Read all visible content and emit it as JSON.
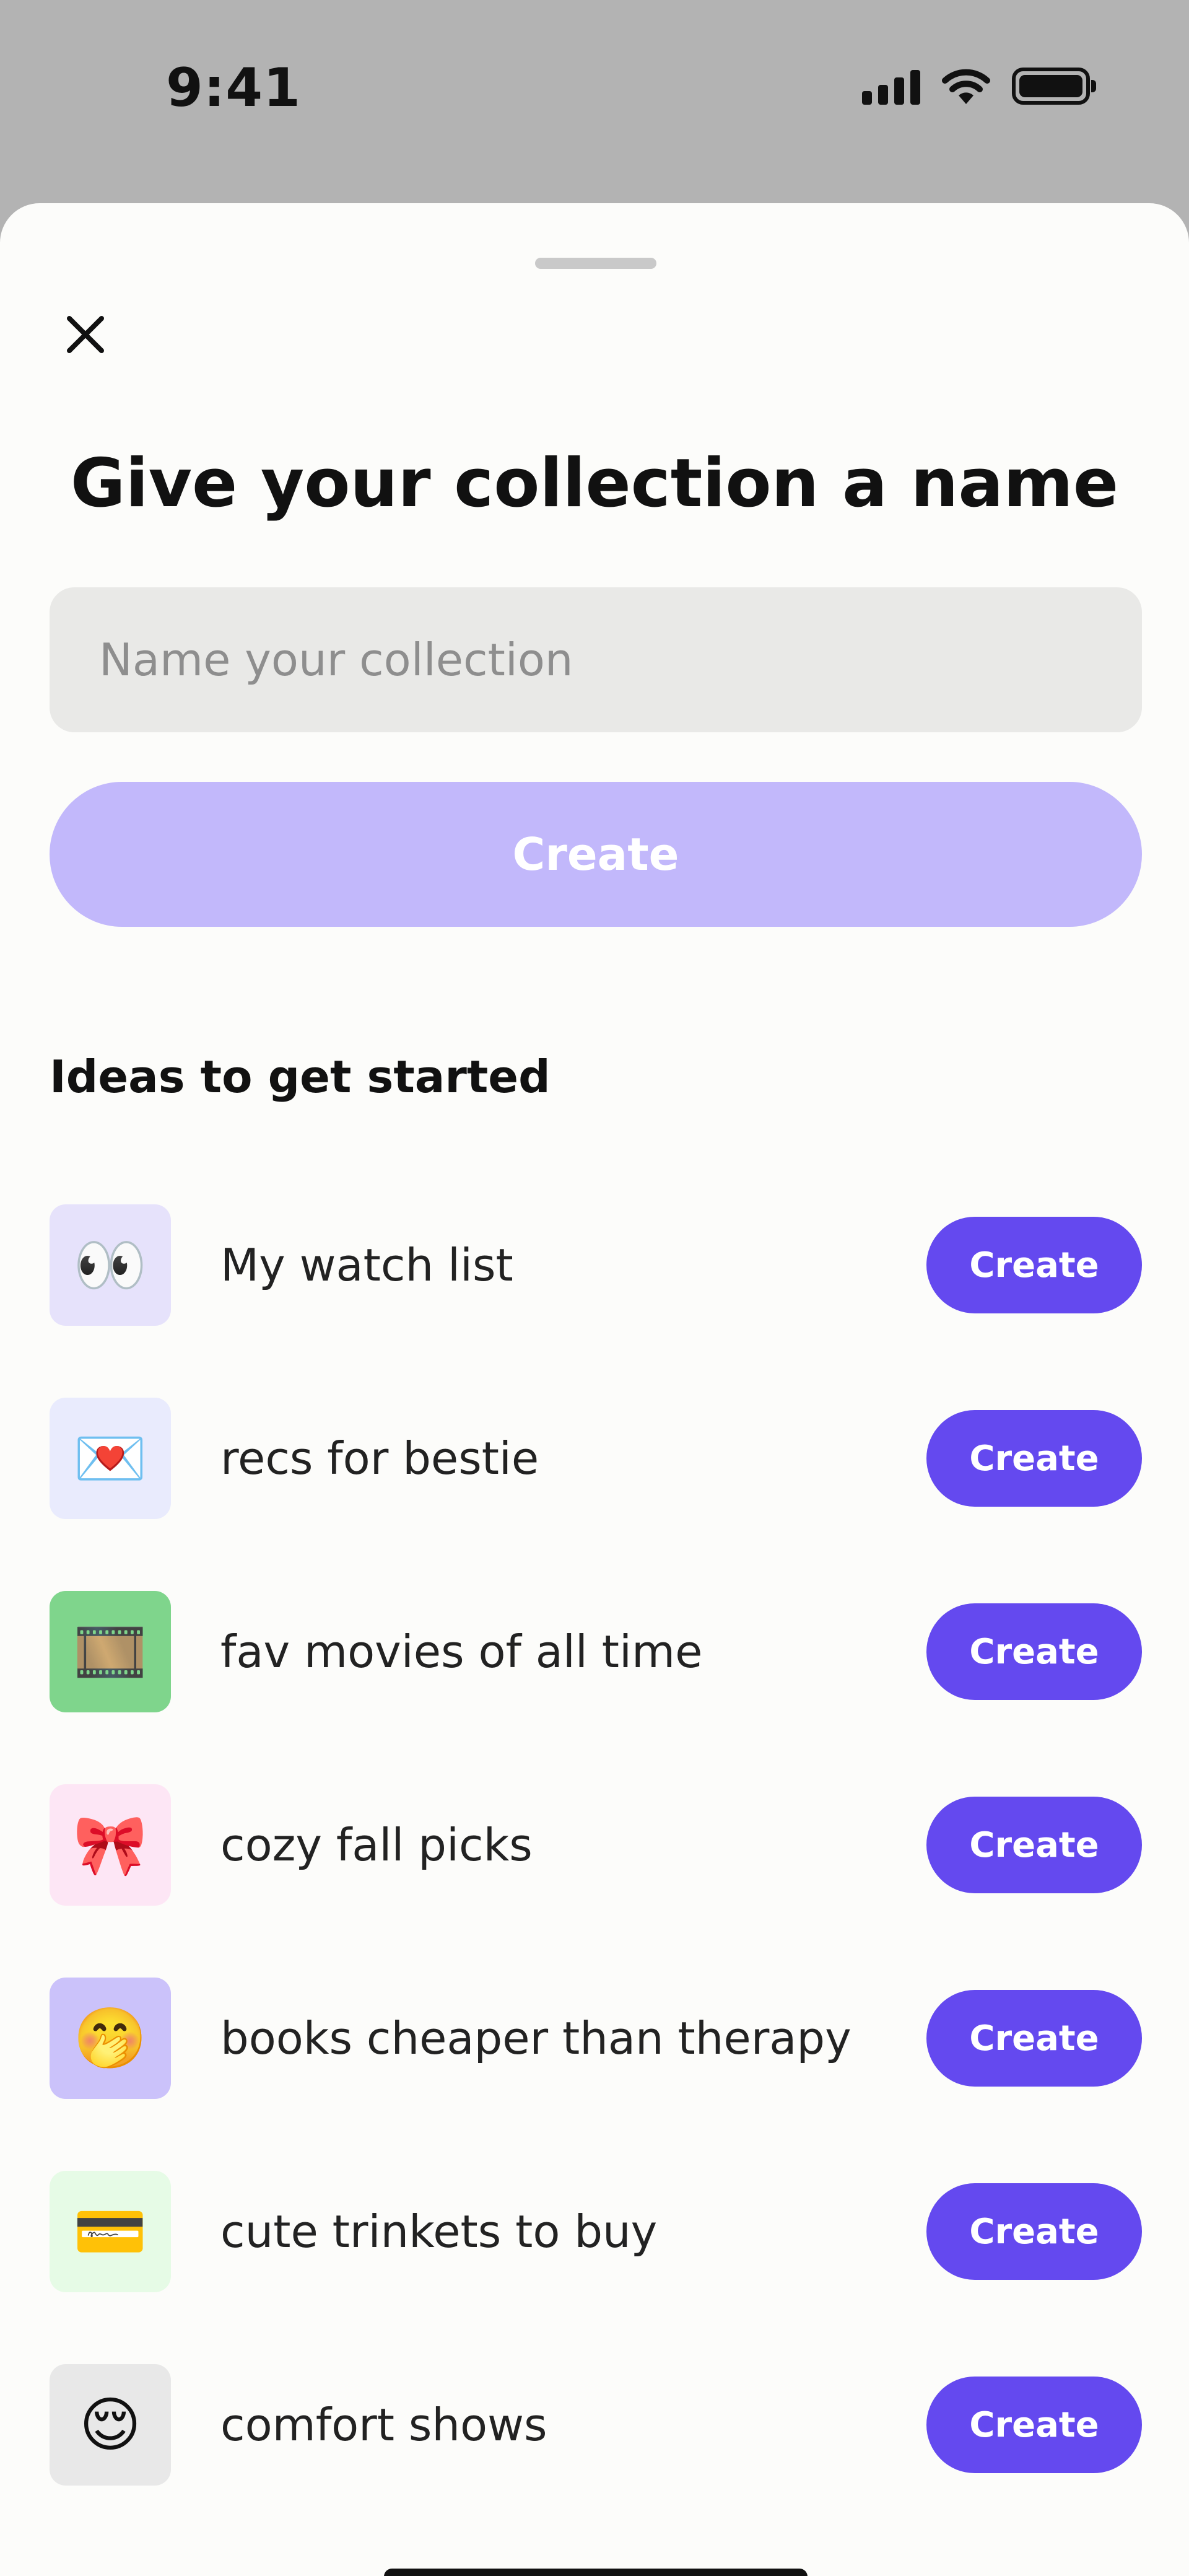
{
  "status_bar": {
    "time": "9:41"
  },
  "sheet": {
    "title": "Give your collection a name",
    "input": {
      "placeholder": "Name your collection",
      "value": ""
    },
    "create_label": "Create",
    "section_heading": "Ideas to get started",
    "ideas": [
      {
        "emoji": "👀",
        "label": "My watch list",
        "tile_color": "#e6e2fb",
        "button": "Create"
      },
      {
        "emoji": "💌",
        "label": "recs for bestie",
        "tile_color": "#e9ebfd",
        "button": "Create"
      },
      {
        "emoji": "🎞️",
        "label": "fav movies of all time",
        "tile_color": "#7fd58c",
        "button": "Create"
      },
      {
        "emoji": "🎀",
        "label": "cozy fall picks",
        "tile_color": "#fde6f5",
        "button": "Create"
      },
      {
        "emoji": "🤭",
        "label": "books cheaper than therapy",
        "tile_color": "#cbc2fa",
        "button": "Create"
      },
      {
        "emoji": "💳",
        "label": "cute trinkets to buy",
        "tile_color": "#e6fbe6",
        "button": "Create"
      },
      {
        "emoji": "😌",
        "label": "comfort shows",
        "tile_color": "#e8e8e8",
        "button": "Create"
      }
    ]
  },
  "colors": {
    "accent": "#6449ef",
    "accent_disabled": "#c2b8fb",
    "sheet_bg": "#fcfcfa",
    "backdrop": "#b3b3b3"
  },
  "icons": {
    "close": "close-icon",
    "signal": "cellular-signal-icon",
    "wifi": "wifi-icon",
    "battery": "battery-icon"
  }
}
